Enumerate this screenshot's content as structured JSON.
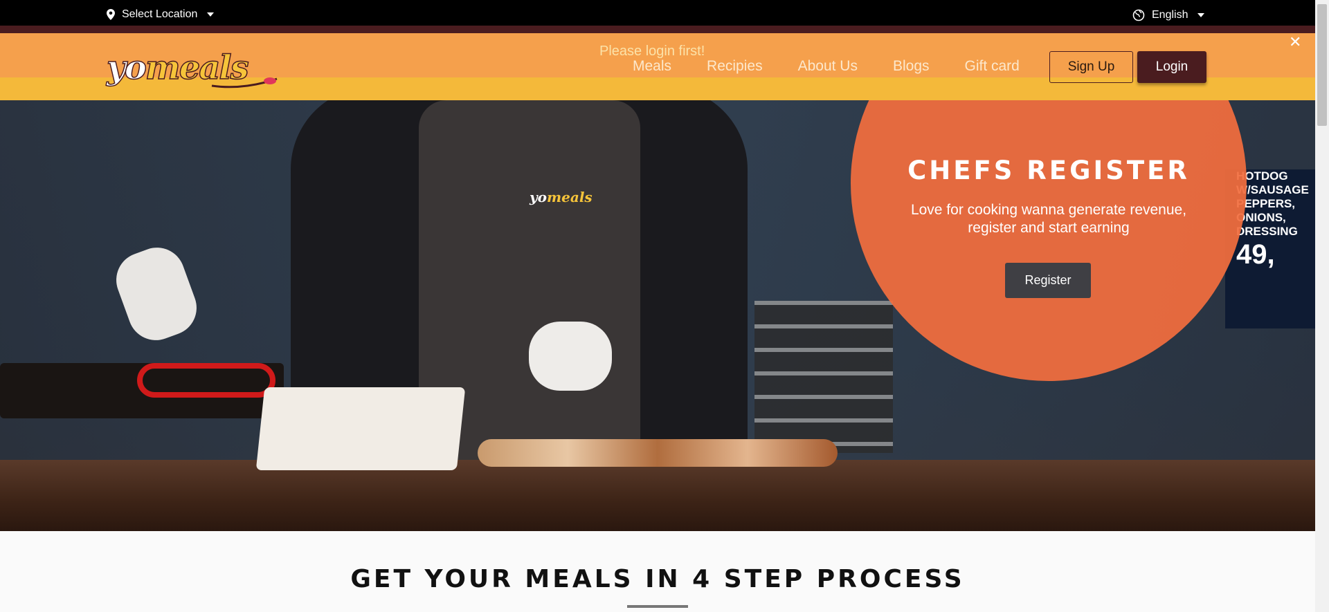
{
  "topbar": {
    "location_label": "Select Location",
    "location_icon": "map-pin-icon",
    "language_label": "English",
    "language_icon": "globe-icon"
  },
  "header": {
    "logo_yo": "yo",
    "logo_meals": "meals",
    "alert": "Please login first!",
    "nav": [
      "Meals",
      "Recipies",
      "About Us",
      "Blogs",
      "Gift card"
    ],
    "signup_label": "Sign Up",
    "login_label": "Login",
    "close_label": "✕"
  },
  "hero": {
    "apron_logo_yo": "yo",
    "apron_logo_meals": "meals",
    "menu_board": [
      "HOTDOG",
      "W/SAUSAGE",
      "PEPPERS,",
      "ONIONS,",
      "DRESSING",
      "49,"
    ],
    "title": "CHEFS REGISTER",
    "subtitle": "Love for cooking wanna generate revenue, register and start earning",
    "register_label": "Register"
  },
  "steps": {
    "title": "GET YOUR MEALS IN 4 STEP PROCESS"
  },
  "colors": {
    "header_orange": "#f5a04c",
    "header_yellow": "#f4b93a",
    "brand_maroon": "#4a1c1f",
    "circle_orange": "#f26e3e"
  }
}
